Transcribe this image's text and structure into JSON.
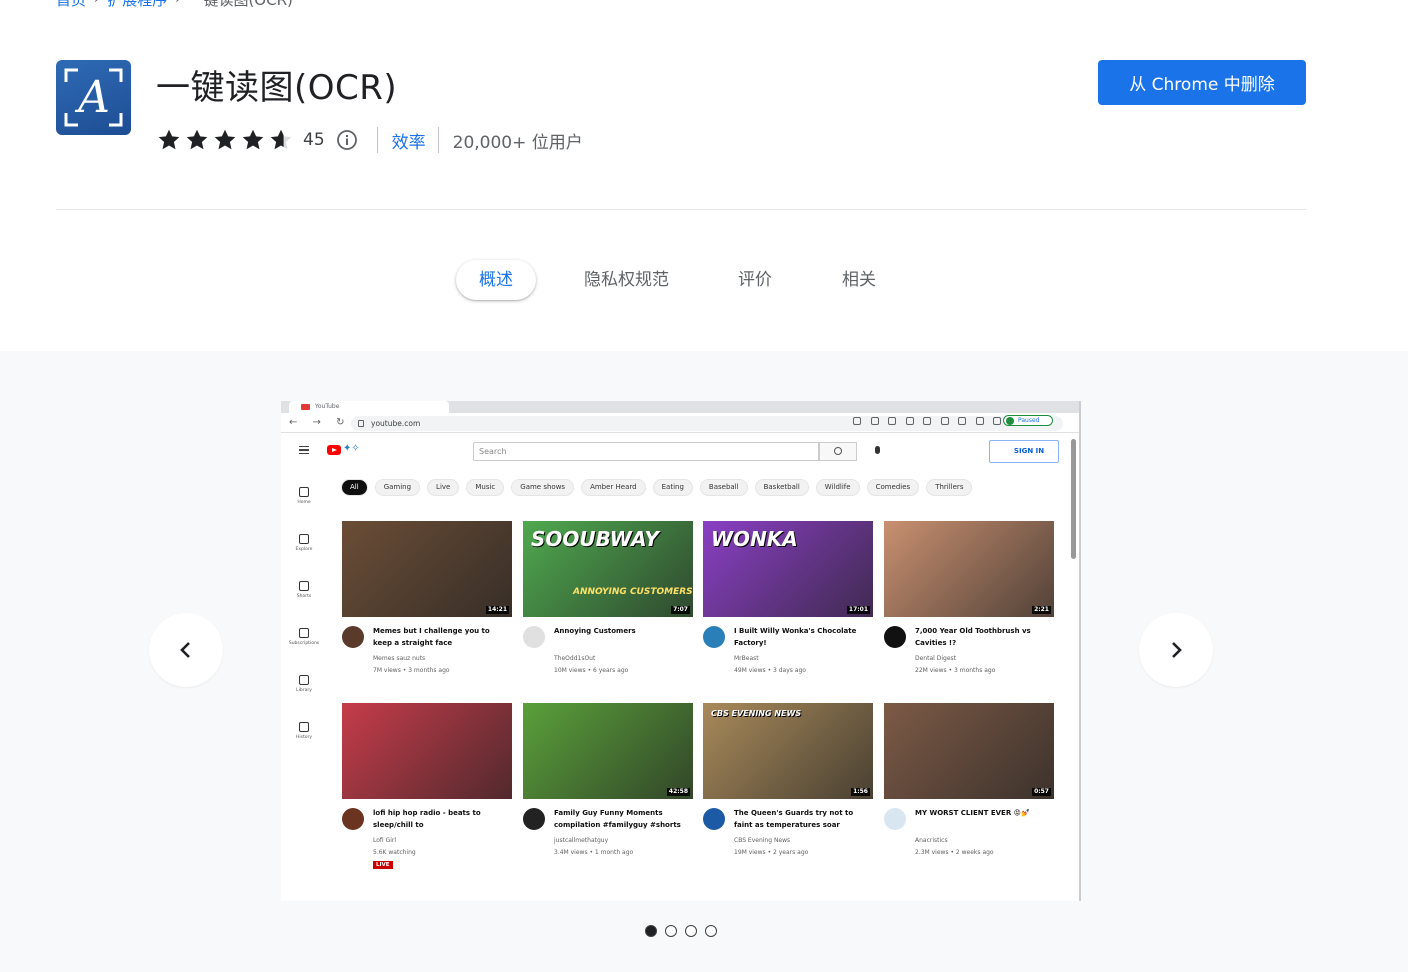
{
  "breadcrumb": {
    "home": "首页",
    "extensions": "扩展程序",
    "current": "一键读图(OCR)"
  },
  "app": {
    "title": "一键读图(OCR)",
    "logo_letter": "A",
    "rating": 4.6,
    "rating_count": "45",
    "category": "效率",
    "users": "20,000+ 位用户",
    "remove_label": "从 Chrome 中删除"
  },
  "tabs": [
    {
      "label": "概述",
      "active": true
    },
    {
      "label": "隐私权规范",
      "active": false
    },
    {
      "label": "评价",
      "active": false
    },
    {
      "label": "相关",
      "active": false
    }
  ],
  "gallery": {
    "slide_count": 4,
    "active_index": 0,
    "screenshot": {
      "url": "youtube.com",
      "tab_title": "YouTube",
      "paused_label": "Paused",
      "search_placeholder": "Search",
      "sign_in": "SIGN IN",
      "chips": [
        "All",
        "Gaming",
        "Live",
        "Music",
        "Game shows",
        "Amber Heard",
        "Eating",
        "Baseball",
        "Basketball",
        "Wildlife",
        "Comedies",
        "Thrillers"
      ],
      "sidebar": [
        "Home",
        "Explore",
        "Shorts",
        "Subscriptions",
        "Library",
        "History"
      ],
      "videos": [
        {
          "title": "Memes but I challenge you to keep a straight face",
          "channel": "Memes sauz nuts",
          "stats": "7M views • 3 months ago",
          "duration": "14:21",
          "thumb": "#6b4d36",
          "avatar": "#5a3a2a"
        },
        {
          "title": "Annoying Customers",
          "channel": "TheOdd1sOut",
          "stats": "10M views • 6 years ago",
          "duration": "7:07",
          "thumb": "#4fa94f",
          "avatar": "#e0e0e0",
          "thumb_text1": "SOOUBWAY",
          "thumb_text2": "ANNOYING CUSTOMERS"
        },
        {
          "title": "I Built Willy Wonka's Chocolate Factory!",
          "channel": "MrBeast",
          "stats": "49M views • 3 days ago",
          "duration": "17:01",
          "thumb": "#8a3fc4",
          "avatar": "#2a7fb8",
          "thumb_text1": "WONKA"
        },
        {
          "title": "7,000 Year Old Toothbrush vs Cavities !?",
          "channel": "Dental Digest",
          "stats": "22M views • 3 months ago",
          "duration": "2:21",
          "thumb": "#c99070",
          "avatar": "#111111"
        },
        {
          "title": "lofi hip hop radio - beats to sleep/chill to",
          "channel": "Lofi Girl",
          "stats": "5.6K watching",
          "live": "LIVE",
          "thumb": "#c63c4a",
          "avatar": "#6a3420"
        },
        {
          "title": "Family Guy Funny Moments compilation #familyguy #shorts",
          "channel": "justcallmethatguy",
          "stats": "3.4M views • 1 month ago",
          "duration": "42:58",
          "thumb": "#5aa03a",
          "avatar": "#222222"
        },
        {
          "title": "The Queen's Guards try not to faint as temperatures soar",
          "channel": "CBS Evening News",
          "stats": "19M views • 2 years ago",
          "duration": "1:56",
          "thumb": "#a98a5a",
          "avatar": "#1c5aa6",
          "thumb_text1": "CBS EVENING NEWS"
        },
        {
          "title": "MY WORST CLIENT EVER 😡💅",
          "channel": "Anacristics",
          "stats": "2.3M views • 2 weeks ago",
          "duration": "0:57",
          "thumb": "#7d5a46",
          "avatar": "#d8e6f2"
        }
      ]
    }
  },
  "colors": {
    "accent": "#1a73e8",
    "logo_bg": "#2a5ea8",
    "star": "#202124"
  },
  "icons": {
    "prev": "chevron-left-icon",
    "next": "chevron-right-icon",
    "info": "info-icon",
    "star": "star-icon"
  }
}
